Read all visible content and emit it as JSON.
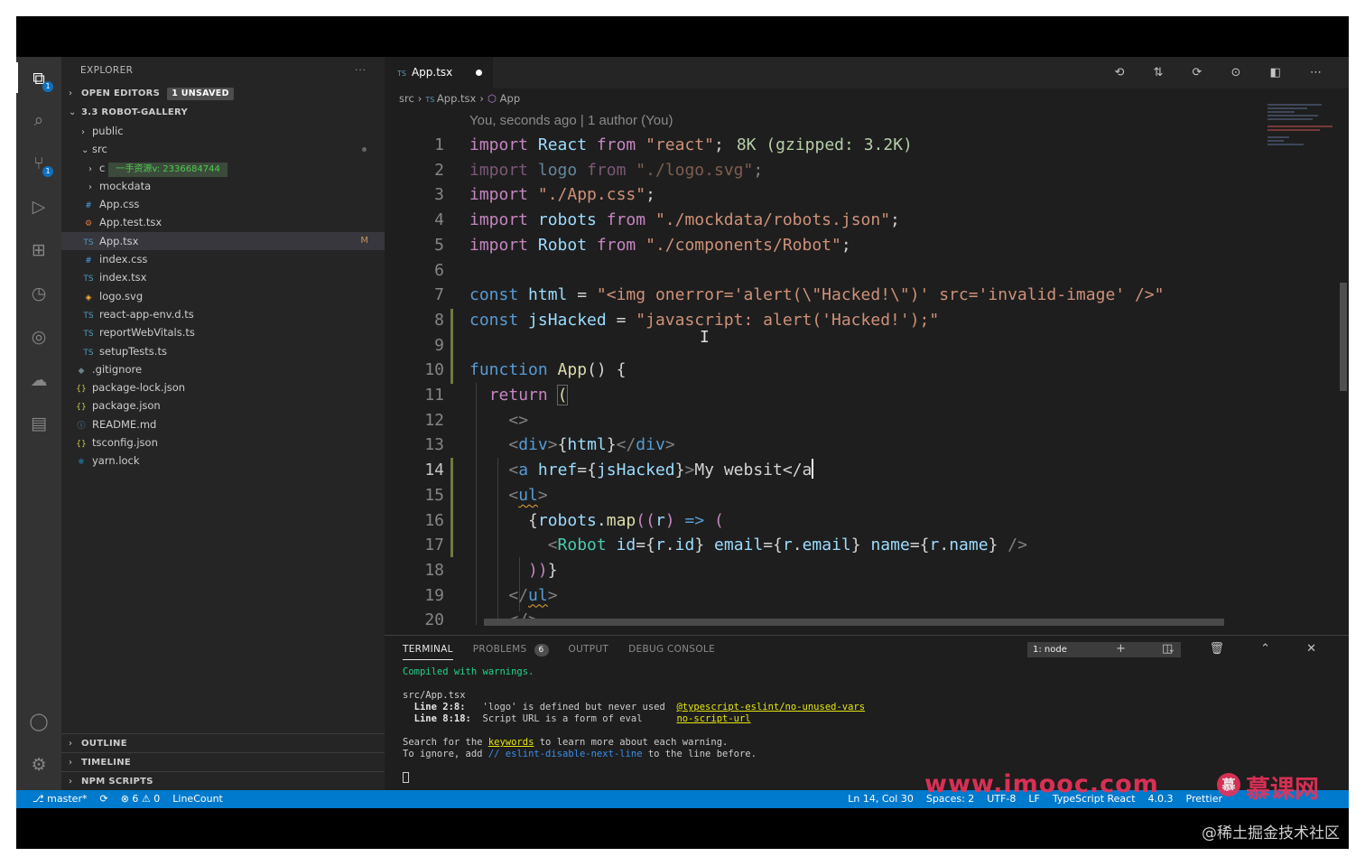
{
  "activity_bar": {
    "items": [
      {
        "name": "explorer-icon",
        "glyph": "⧉",
        "badge": "1"
      },
      {
        "name": "search-icon",
        "glyph": "⌕"
      },
      {
        "name": "source-control-icon",
        "glyph": "⑂",
        "badge": "1"
      },
      {
        "name": "run-debug-icon",
        "glyph": "▷"
      },
      {
        "name": "extensions-icon",
        "glyph": "⊞"
      },
      {
        "name": "timeline-icon",
        "glyph": "◷"
      },
      {
        "name": "remote-icon",
        "glyph": "◎"
      },
      {
        "name": "docker-icon",
        "glyph": "☁"
      },
      {
        "name": "notebook-icon",
        "glyph": "▤"
      }
    ],
    "account_glyph": "◯",
    "settings_glyph": "⚙"
  },
  "sidebar": {
    "title": "EXPLORER",
    "more": "···",
    "open_editors": "OPEN EDITORS",
    "unsaved": "1 UNSAVED",
    "project": "3.3 ROBOT-GALLERY",
    "tree": [
      {
        "label": "public",
        "type": "folder",
        "depth": 1
      },
      {
        "label": "src",
        "type": "folder-open",
        "depth": 1
      },
      {
        "label": "c",
        "type": "folder",
        "depth": 2,
        "overlay": "一手资源v: 2336684744"
      },
      {
        "label": "mockdata",
        "type": "folder",
        "depth": 2
      },
      {
        "label": "App.css",
        "type": "css",
        "depth": 2
      },
      {
        "label": "App.test.tsx",
        "type": "test",
        "depth": 2
      },
      {
        "label": "App.tsx",
        "type": "ts",
        "depth": 2,
        "modified": "M",
        "selected": true
      },
      {
        "label": "index.css",
        "type": "css",
        "depth": 2
      },
      {
        "label": "index.tsx",
        "type": "ts",
        "depth": 2
      },
      {
        "label": "logo.svg",
        "type": "svg",
        "depth": 2
      },
      {
        "label": "react-app-env.d.ts",
        "type": "ts",
        "depth": 2
      },
      {
        "label": "reportWebVitals.ts",
        "type": "ts",
        "depth": 2
      },
      {
        "label": "setupTests.ts",
        "type": "ts",
        "depth": 2
      },
      {
        "label": ".gitignore",
        "type": "git",
        "depth": 1
      },
      {
        "label": "package-lock.json",
        "type": "json",
        "depth": 1
      },
      {
        "label": "package.json",
        "type": "json",
        "depth": 1
      },
      {
        "label": "README.md",
        "type": "md",
        "depth": 1
      },
      {
        "label": "tsconfig.json",
        "type": "json",
        "depth": 1
      },
      {
        "label": "yarn.lock",
        "type": "yarn",
        "depth": 1
      }
    ],
    "bottom_sections": [
      "OUTLINE",
      "TIMELINE",
      "NPM SCRIPTS"
    ]
  },
  "editor": {
    "tab_label": "App.tsx",
    "tab_icon": "TS",
    "actions": "⟲ ⇅ ⟳ ⊙ ◧ ⋯",
    "breadcrumb": [
      "src",
      "App.tsx",
      "App"
    ],
    "blame": "You, seconds ago | 1 author (You)",
    "line_numbers": [
      "1",
      "2",
      "3",
      "4",
      "5",
      "6",
      "7",
      "8",
      "9",
      "10",
      "11",
      "12",
      "13",
      "14",
      "15",
      "16",
      "17",
      "18",
      "19",
      "20"
    ],
    "bundle_size": "8K (gzipped: 3.2K)",
    "cursor_line": 14
  },
  "panel": {
    "tabs": [
      "TERMINAL",
      "PROBLEMS",
      "OUTPUT",
      "DEBUG CONSOLE"
    ],
    "problems_count": "6",
    "terminal_select": "1: node",
    "actions": "+ ◫ 🗑 ⌃ ✕",
    "terminal_lines": {
      "compiled": "Compiled with warnings.",
      "file": "src/App.tsx",
      "w1_loc": "  Line 2:8:  ",
      "w1_msg": " 'logo' is defined but never used  ",
      "w1_rule": "@typescript-eslint/no-unused-vars",
      "w2_loc": "  Line 8:18: ",
      "w2_msg": " Script URL is a form of eval      ",
      "w2_rule": "no-script-url",
      "search_pre": "Search for the ",
      "search_kw": "keywords",
      "search_post": " to learn more about each warning.",
      "ignore_pre": "To ignore, add ",
      "ignore_kw": "// eslint-disable-next-line",
      "ignore_post": " to the line before."
    }
  },
  "status_bar": {
    "branch": "⎇ master*",
    "sync": "⟳",
    "problems": "⊗ 6 ⚠ 0",
    "linecount": "LineCount",
    "position": "Ln 14, Col 30",
    "spaces": "Spaces: 2",
    "encoding": "UTF-8",
    "eol": "LF",
    "language": "TypeScript React",
    "version": "4.0.3",
    "prettier": "Prettier"
  },
  "overlays": {
    "imooc_url": "www.imooc.com",
    "imooc_logo": "慕",
    "imooc_cn": "慕课网",
    "juejin": "@稀土掘金技术社区"
  },
  "colors": {
    "status_bar": "#007acc",
    "sidebar": "#252526",
    "editor": "#1e1e1e",
    "activity_bar": "#333333"
  }
}
